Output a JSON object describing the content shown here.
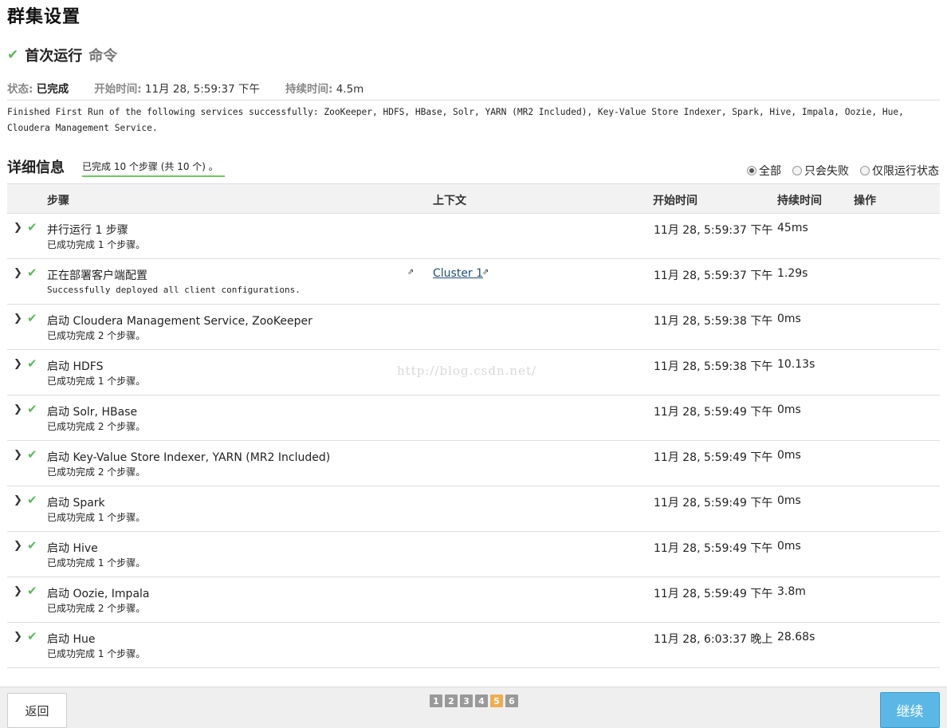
{
  "page": {
    "title": "群集设置"
  },
  "command": {
    "check_icon": "check-icon",
    "name": "首次运行",
    "type": "命令"
  },
  "meta": {
    "status_label": "状态:",
    "status_value": "已完成",
    "start_label": "开始时间:",
    "start_value": "11月 28, 5:59:37 下午",
    "duration_label": "持续时间:",
    "duration_value": "4.5m"
  },
  "summary": "Finished First Run of the following services successfully: ZooKeeper, HDFS, HBase, Solr, YARN (MR2 Included), Key-Value Store Indexer, Spark, Hive, Impala, Oozie, Hue, Cloudera Management Service.",
  "details": {
    "title": "详细信息",
    "progress": "已完成 10 个步骤 (共 10 个) 。"
  },
  "filters": {
    "all": "全部",
    "failed_only": "只会失败",
    "running_only": "仅限运行状态",
    "selected": "all"
  },
  "table": {
    "headers": {
      "step": "步骤",
      "context": "上下文",
      "start_time": "开始时间",
      "duration": "持续时间",
      "actions": "操作"
    },
    "rows": [
      {
        "name": "并行运行 1 步骤",
        "sub": "已成功完成 1 个步骤。",
        "context": "",
        "start": "11月 28, 5:59:37 下午",
        "duration": "45ms"
      },
      {
        "name": "正在部署客户端配置",
        "sub": "Successfully deployed all client configurations.",
        "context": "Cluster 1",
        "start": "11月 28, 5:59:37 下午",
        "duration": "1.29s"
      },
      {
        "name": "启动 Cloudera Management Service, ZooKeeper",
        "sub": "已成功完成 2 个步骤。",
        "context": "",
        "start": "11月 28, 5:59:38 下午",
        "duration": "0ms"
      },
      {
        "name": "启动 HDFS",
        "sub": "已成功完成 1 个步骤。",
        "context": "",
        "start": "11月 28, 5:59:38 下午",
        "duration": "10.13s"
      },
      {
        "name": "启动 Solr, HBase",
        "sub": "已成功完成 2 个步骤。",
        "context": "",
        "start": "11月 28, 5:59:49 下午",
        "duration": "0ms"
      },
      {
        "name": "启动 Key-Value Store Indexer, YARN (MR2 Included)",
        "sub": "已成功完成 2 个步骤。",
        "context": "",
        "start": "11月 28, 5:59:49 下午",
        "duration": "0ms"
      },
      {
        "name": "启动 Spark",
        "sub": "已成功完成 1 个步骤。",
        "context": "",
        "start": "11月 28, 5:59:49 下午",
        "duration": "0ms"
      },
      {
        "name": "启动 Hive",
        "sub": "已成功完成 1 个步骤。",
        "context": "",
        "start": "11月 28, 5:59:49 下午",
        "duration": "0ms"
      },
      {
        "name": "启动 Oozie, Impala",
        "sub": "已成功完成 2 个步骤。",
        "context": "",
        "start": "11月 28, 5:59:49 下午",
        "duration": "3.8m"
      },
      {
        "name": "启动 Hue",
        "sub": "已成功完成 1 个步骤。",
        "context": "",
        "start": "11月 28, 6:03:37 晚上",
        "duration": "28.68s"
      }
    ]
  },
  "watermark": "http://blog.csdn.net/",
  "footer": {
    "back_label": "返回",
    "next_label": "继续",
    "pages": [
      "1",
      "2",
      "3",
      "4",
      "5",
      "6"
    ],
    "active_page": "5"
  },
  "colors": {
    "success": "#5cb85c",
    "primary_button": "#5bb8e6",
    "active_page": "#f0ad4e",
    "link": "#1f4e79"
  }
}
